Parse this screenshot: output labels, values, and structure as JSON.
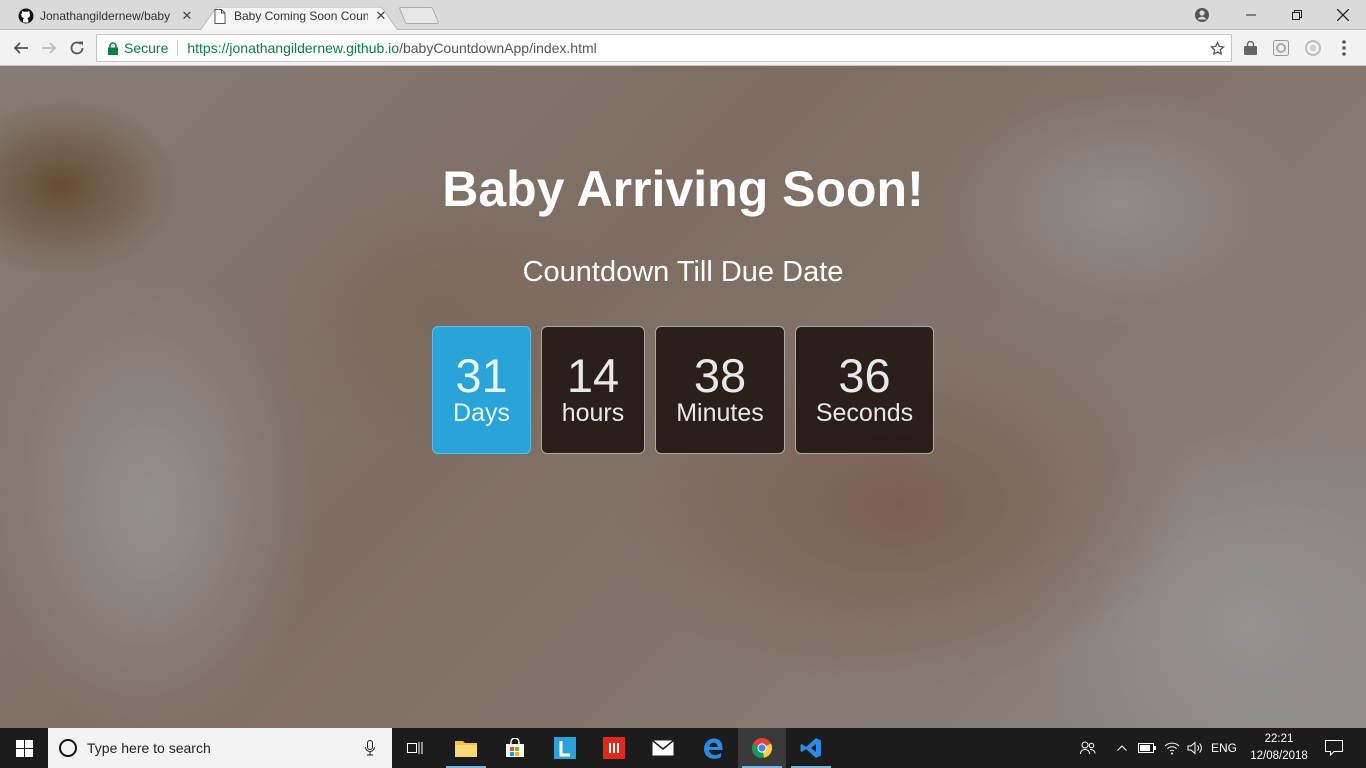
{
  "browser": {
    "tabs": [
      {
        "title": "Jonathangildernew/baby",
        "state": "inactive"
      },
      {
        "title": "Baby Coming Soon Coun",
        "state": "active"
      }
    ],
    "security_label": "Secure",
    "url_host": "https://jonathangildernew.github.io",
    "url_path": "/babyCountdownApp/index.html"
  },
  "page": {
    "heading": "Baby Arriving Soon!",
    "subheading": "Countdown Till Due Date",
    "countdown": {
      "days": {
        "value": "31",
        "label": "Days"
      },
      "hours": {
        "value": "14",
        "label": "hours"
      },
      "minutes": {
        "value": "38",
        "label": "Minutes"
      },
      "seconds": {
        "value": "36",
        "label": "Seconds"
      }
    },
    "colors": {
      "highlight": "#2aa3d8",
      "box_dark": "#1a0e0c",
      "text": "#ffffff"
    }
  },
  "taskbar": {
    "search_placeholder": "Type here to search",
    "language": "ENG",
    "time": "22:21",
    "date": "12/08/2018",
    "apps": [
      "task-view-icon",
      "file-explorer-icon",
      "store-icon",
      "l-app-icon",
      "red-app-icon",
      "mail-icon",
      "edge-icon",
      "chrome-icon",
      "vscode-icon"
    ]
  }
}
